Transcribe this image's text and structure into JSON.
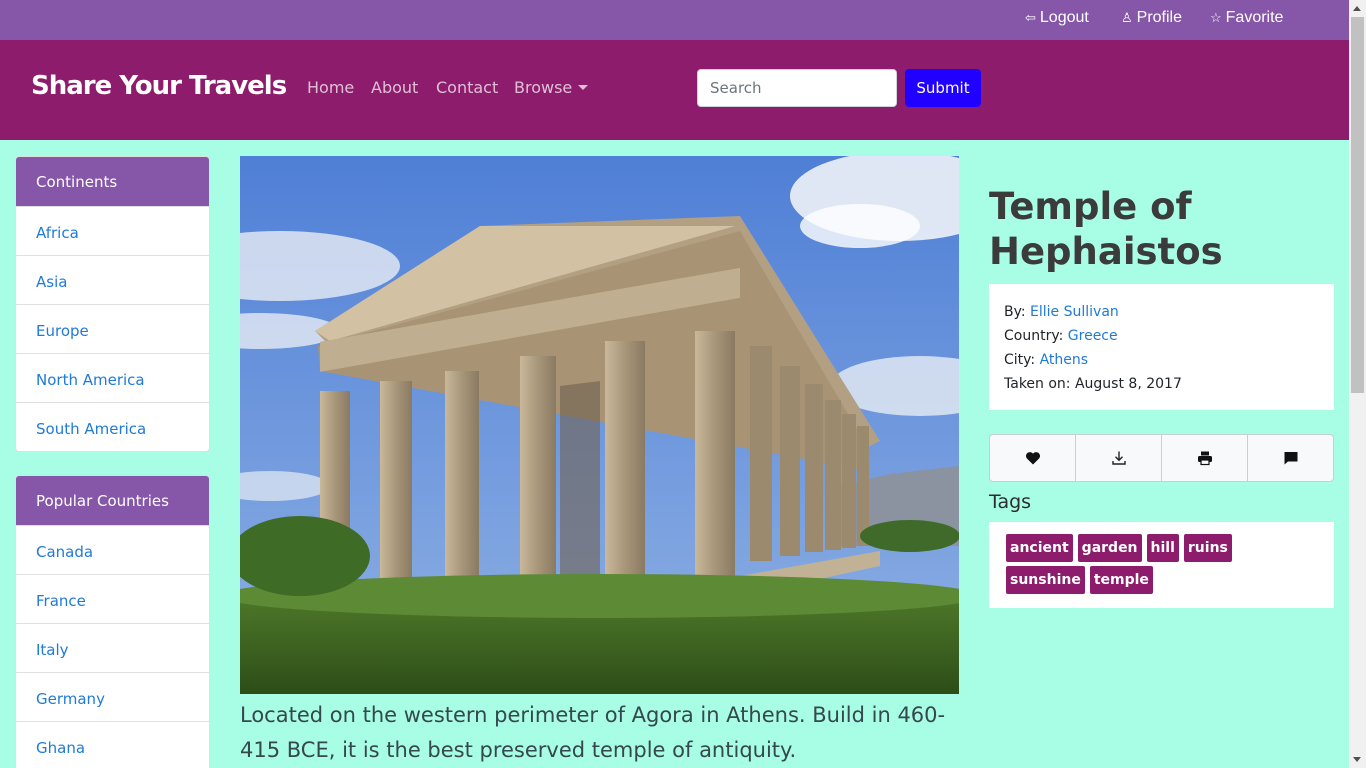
{
  "topbar": {
    "logout": "Logout",
    "profile": "Profile",
    "favorite": "Favorite"
  },
  "nav": {
    "brand": "Share Your Travels",
    "links": [
      "Home",
      "About",
      "Contact",
      "Browse"
    ],
    "search_placeholder": "Search",
    "submit": "Submit"
  },
  "sidebar": {
    "continents": {
      "title": "Continents",
      "items": [
        "Africa",
        "Asia",
        "Europe",
        "North America",
        "South America"
      ]
    },
    "countries": {
      "title": "Popular Countries",
      "items": [
        "Canada",
        "France",
        "Italy",
        "Germany",
        "Ghana"
      ]
    }
  },
  "photo": {
    "title": "Temple of Hephaistos",
    "description": "Located on the western perimeter of Agora in Athens. Build in 460-415 BCE, it is the best preserved temple of antiquity.",
    "meta": {
      "by_label": "By:",
      "by": "Ellie Sullivan",
      "country_label": "Country:",
      "country": "Greece",
      "city_label": "City:",
      "city": "Athens",
      "taken_label": "Taken on:",
      "taken": "August 8, 2017"
    },
    "actions": [
      "heart-icon",
      "download-icon",
      "print-icon",
      "comment-icon"
    ],
    "tags_title": "Tags",
    "tags": [
      "ancient",
      "garden",
      "hill",
      "ruins",
      "sunshine",
      "temple"
    ]
  },
  "colors": {
    "page_bg": "#a8fde5",
    "topbar": "#8656a8",
    "navbar": "#8e1c6c",
    "submit": "#2000ff",
    "link": "#1f7ad8",
    "tag": "#8e1c6c"
  }
}
